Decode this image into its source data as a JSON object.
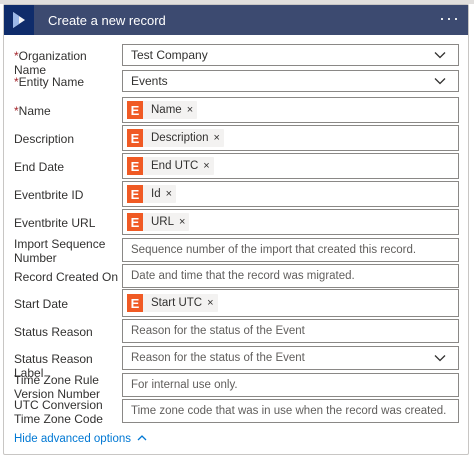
{
  "header": {
    "title": "Create a new record",
    "more": "···"
  },
  "fields": [
    {
      "label": "Organization Name",
      "required": "*",
      "value": "Test Company",
      "kind": "select"
    },
    {
      "label": "Entity Name",
      "required": "*",
      "value": "Events",
      "kind": "select"
    },
    {
      "label": "Name",
      "required": "*",
      "token": "Name",
      "kind": "token"
    },
    {
      "label": "Description",
      "token": "Description",
      "kind": "token"
    },
    {
      "label": "End Date",
      "token": "End UTC",
      "kind": "token"
    },
    {
      "label": "Eventbrite ID",
      "token": "Id",
      "kind": "token"
    },
    {
      "label": "Eventbrite URL",
      "token": "URL",
      "kind": "token"
    },
    {
      "label": "Import Sequence Number",
      "placeholder": "Sequence number of the import that created this record.",
      "kind": "text"
    },
    {
      "label": "Record Created On",
      "placeholder": "Date and time that the record was migrated.",
      "kind": "text"
    },
    {
      "label": "Start Date",
      "token": "Start UTC",
      "kind": "token"
    },
    {
      "label": "Status Reason",
      "placeholder": "Reason for the status of the Event",
      "kind": "text"
    },
    {
      "label": "Status Reason Label",
      "placeholder": "Reason for the status of the Event",
      "kind": "select"
    },
    {
      "label": "Time Zone Rule Version Number",
      "placeholder": "For internal use only.",
      "kind": "text"
    },
    {
      "label": "UTC Conversion Time Zone Code",
      "placeholder": "Time zone code that was in use when the record was created.",
      "kind": "text"
    }
  ],
  "token_icon_letter": "E",
  "token_remove": "×",
  "footer": {
    "link": "Hide advanced options"
  },
  "colors": {
    "header": "#3c4a70",
    "token": "#f05a24",
    "link": "#0078d4"
  }
}
